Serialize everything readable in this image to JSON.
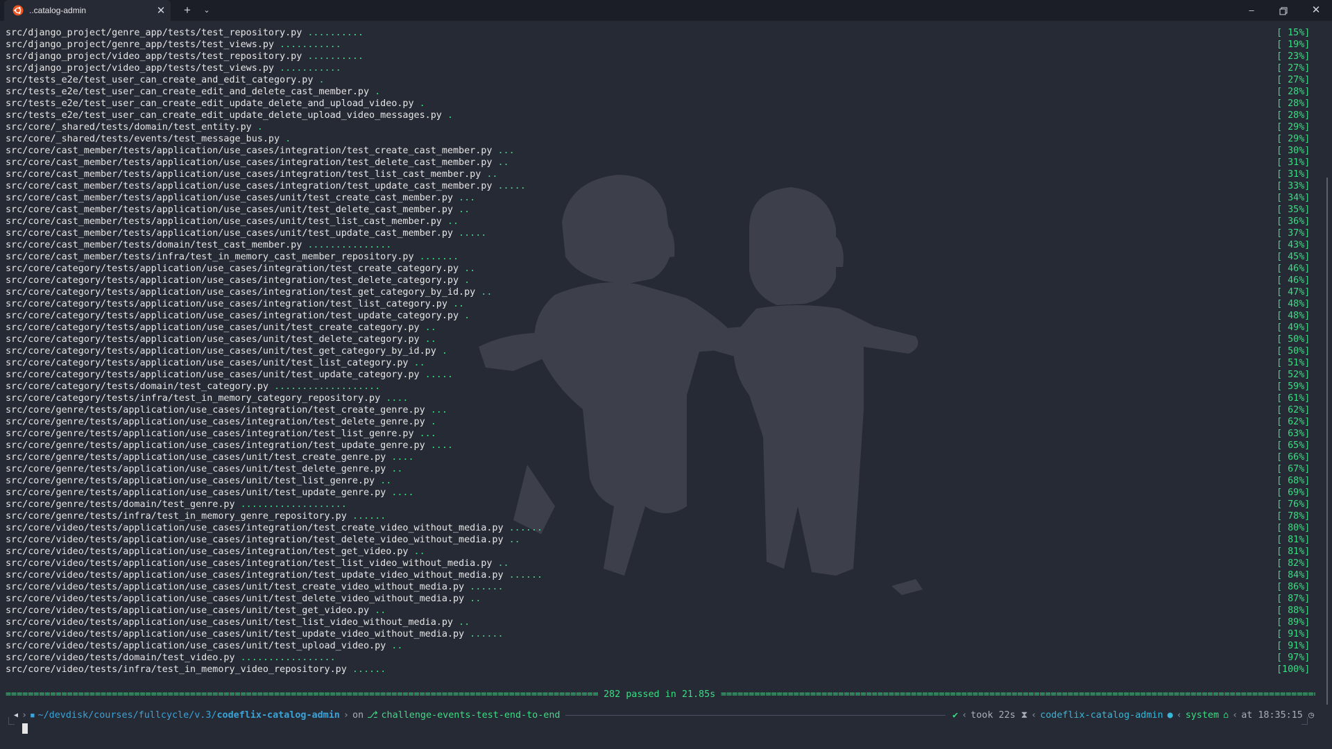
{
  "window": {
    "tab_title": "..catalog-admin",
    "tab_icon": "ubuntu-icon",
    "new_tab_icon": "+",
    "dropdown_icon": "⌄",
    "close_icon": "✕",
    "minimize_icon": "–",
    "maximize_icon": "❐",
    "window_close_icon": "✕"
  },
  "colors": {
    "background": "#262a35",
    "titlebar": "#1b1e26",
    "text": "#e6e6e6",
    "pass_green": "#3ddc84",
    "path_blue": "#3aa3d8"
  },
  "test_lines": [
    {
      "path": "src/django_project/genre_app/tests/test_repository.py",
      "dots": "..........",
      "pct": "[ 15%]"
    },
    {
      "path": "src/django_project/genre_app/tests/test_views.py",
      "dots": "...........",
      "pct": "[ 19%]"
    },
    {
      "path": "src/django_project/video_app/tests/test_repository.py",
      "dots": "..........",
      "pct": "[ 23%]"
    },
    {
      "path": "src/django_project/video_app/tests/test_views.py",
      "dots": "...........",
      "pct": "[ 27%]"
    },
    {
      "path": "src/tests_e2e/test_user_can_create_and_edit_category.py",
      "dots": ".",
      "pct": "[ 27%]"
    },
    {
      "path": "src/tests_e2e/test_user_can_create_edit_and_delete_cast_member.py",
      "dots": ".",
      "pct": "[ 28%]"
    },
    {
      "path": "src/tests_e2e/test_user_can_create_edit_update_delete_and_upload_video.py",
      "dots": ".",
      "pct": "[ 28%]"
    },
    {
      "path": "src/tests_e2e/test_user_can_create_edit_update_delete_upload_video_messages.py",
      "dots": ".",
      "pct": "[ 28%]"
    },
    {
      "path": "src/core/_shared/tests/domain/test_entity.py",
      "dots": ".",
      "pct": "[ 29%]"
    },
    {
      "path": "src/core/_shared/tests/events/test_message_bus.py",
      "dots": ".",
      "pct": "[ 29%]"
    },
    {
      "path": "src/core/cast_member/tests/application/use_cases/integration/test_create_cast_member.py",
      "dots": "...",
      "pct": "[ 30%]"
    },
    {
      "path": "src/core/cast_member/tests/application/use_cases/integration/test_delete_cast_member.py",
      "dots": "..",
      "pct": "[ 31%]"
    },
    {
      "path": "src/core/cast_member/tests/application/use_cases/integration/test_list_cast_member.py",
      "dots": "..",
      "pct": "[ 31%]"
    },
    {
      "path": "src/core/cast_member/tests/application/use_cases/integration/test_update_cast_member.py",
      "dots": ".....",
      "pct": "[ 33%]"
    },
    {
      "path": "src/core/cast_member/tests/application/use_cases/unit/test_create_cast_member.py",
      "dots": "...",
      "pct": "[ 34%]"
    },
    {
      "path": "src/core/cast_member/tests/application/use_cases/unit/test_delete_cast_member.py",
      "dots": "..",
      "pct": "[ 35%]"
    },
    {
      "path": "src/core/cast_member/tests/application/use_cases/unit/test_list_cast_member.py",
      "dots": "..",
      "pct": "[ 36%]"
    },
    {
      "path": "src/core/cast_member/tests/application/use_cases/unit/test_update_cast_member.py",
      "dots": ".....",
      "pct": "[ 37%]"
    },
    {
      "path": "src/core/cast_member/tests/domain/test_cast_member.py",
      "dots": "...............",
      "pct": "[ 43%]"
    },
    {
      "path": "src/core/cast_member/tests/infra/test_in_memory_cast_member_repository.py",
      "dots": ".......",
      "pct": "[ 45%]"
    },
    {
      "path": "src/core/category/tests/application/use_cases/integration/test_create_category.py",
      "dots": "..",
      "pct": "[ 46%]"
    },
    {
      "path": "src/core/category/tests/application/use_cases/integration/test_delete_category.py",
      "dots": ".",
      "pct": "[ 46%]"
    },
    {
      "path": "src/core/category/tests/application/use_cases/integration/test_get_category_by_id.py",
      "dots": "..",
      "pct": "[ 47%]"
    },
    {
      "path": "src/core/category/tests/application/use_cases/integration/test_list_category.py",
      "dots": "..",
      "pct": "[ 48%]"
    },
    {
      "path": "src/core/category/tests/application/use_cases/integration/test_update_category.py",
      "dots": ".",
      "pct": "[ 48%]"
    },
    {
      "path": "src/core/category/tests/application/use_cases/unit/test_create_category.py",
      "dots": "..",
      "pct": "[ 49%]"
    },
    {
      "path": "src/core/category/tests/application/use_cases/unit/test_delete_category.py",
      "dots": "..",
      "pct": "[ 50%]"
    },
    {
      "path": "src/core/category/tests/application/use_cases/unit/test_get_category_by_id.py",
      "dots": ".",
      "pct": "[ 50%]"
    },
    {
      "path": "src/core/category/tests/application/use_cases/unit/test_list_category.py",
      "dots": "..",
      "pct": "[ 51%]"
    },
    {
      "path": "src/core/category/tests/application/use_cases/unit/test_update_category.py",
      "dots": ".....",
      "pct": "[ 52%]"
    },
    {
      "path": "src/core/category/tests/domain/test_category.py",
      "dots": "...................",
      "pct": "[ 59%]"
    },
    {
      "path": "src/core/category/tests/infra/test_in_memory_category_repository.py",
      "dots": "....",
      "pct": "[ 61%]"
    },
    {
      "path": "src/core/genre/tests/application/use_cases/integration/test_create_genre.py",
      "dots": "...",
      "pct": "[ 62%]"
    },
    {
      "path": "src/core/genre/tests/application/use_cases/integration/test_delete_genre.py",
      "dots": ".",
      "pct": "[ 62%]"
    },
    {
      "path": "src/core/genre/tests/application/use_cases/integration/test_list_genre.py",
      "dots": "...",
      "pct": "[ 63%]"
    },
    {
      "path": "src/core/genre/tests/application/use_cases/integration/test_update_genre.py",
      "dots": "....",
      "pct": "[ 65%]"
    },
    {
      "path": "src/core/genre/tests/application/use_cases/unit/test_create_genre.py",
      "dots": "....",
      "pct": "[ 66%]"
    },
    {
      "path": "src/core/genre/tests/application/use_cases/unit/test_delete_genre.py",
      "dots": "..",
      "pct": "[ 67%]"
    },
    {
      "path": "src/core/genre/tests/application/use_cases/unit/test_list_genre.py",
      "dots": "..",
      "pct": "[ 68%]"
    },
    {
      "path": "src/core/genre/tests/application/use_cases/unit/test_update_genre.py",
      "dots": "....",
      "pct": "[ 69%]"
    },
    {
      "path": "src/core/genre/tests/domain/test_genre.py",
      "dots": "...................",
      "pct": "[ 76%]"
    },
    {
      "path": "src/core/genre/tests/infra/test_in_memory_genre_repository.py",
      "dots": "......",
      "pct": "[ 78%]"
    },
    {
      "path": "src/core/video/tests/application/use_cases/integration/test_create_video_without_media.py",
      "dots": "......",
      "pct": "[ 80%]"
    },
    {
      "path": "src/core/video/tests/application/use_cases/integration/test_delete_video_without_media.py",
      "dots": "..",
      "pct": "[ 81%]"
    },
    {
      "path": "src/core/video/tests/application/use_cases/integration/test_get_video.py",
      "dots": "..",
      "pct": "[ 81%]"
    },
    {
      "path": "src/core/video/tests/application/use_cases/integration/test_list_video_without_media.py",
      "dots": "..",
      "pct": "[ 82%]"
    },
    {
      "path": "src/core/video/tests/application/use_cases/integration/test_update_video_without_media.py",
      "dots": "......",
      "pct": "[ 84%]"
    },
    {
      "path": "src/core/video/tests/application/use_cases/unit/test_create_video_without_media.py",
      "dots": "......",
      "pct": "[ 86%]"
    },
    {
      "path": "src/core/video/tests/application/use_cases/unit/test_delete_video_without_media.py",
      "dots": "..",
      "pct": "[ 87%]"
    },
    {
      "path": "src/core/video/tests/application/use_cases/unit/test_get_video.py",
      "dots": "..",
      "pct": "[ 88%]"
    },
    {
      "path": "src/core/video/tests/application/use_cases/unit/test_list_video_without_media.py",
      "dots": "..",
      "pct": "[ 89%]"
    },
    {
      "path": "src/core/video/tests/application/use_cases/unit/test_update_video_without_media.py",
      "dots": "......",
      "pct": "[ 91%]"
    },
    {
      "path": "src/core/video/tests/application/use_cases/unit/test_upload_video.py",
      "dots": "..",
      "pct": "[ 91%]"
    },
    {
      "path": "src/core/video/tests/domain/test_video.py",
      "dots": ".................",
      "pct": "[ 97%]"
    },
    {
      "path": "src/core/video/tests/infra/test_in_memory_video_repository.py",
      "dots": "......",
      "pct": "[100%]"
    }
  ],
  "summary": {
    "result": "282 passed in 21.85s",
    "separator": "============================================================================================================================================================================"
  },
  "prompt": {
    "os_icon": "◀",
    "folder_icon": "■",
    "path_prefix": "~/devdisk/courses/fullcycle/v.3/",
    "path_current": "codeflix-catalog-admin",
    "on_label": "on",
    "git_icon": "⎇",
    "branch": "challenge-events-test-end-to-end",
    "status_icon": "✔",
    "took_label": "took",
    "duration": "22s",
    "hourglass_icon": "⧗",
    "env": "codeflix-catalog-admin",
    "python_icon": "●",
    "system": "system",
    "home_icon": "⌂",
    "at_label": "at",
    "time": "18:35:15",
    "clock_icon": "◷"
  }
}
